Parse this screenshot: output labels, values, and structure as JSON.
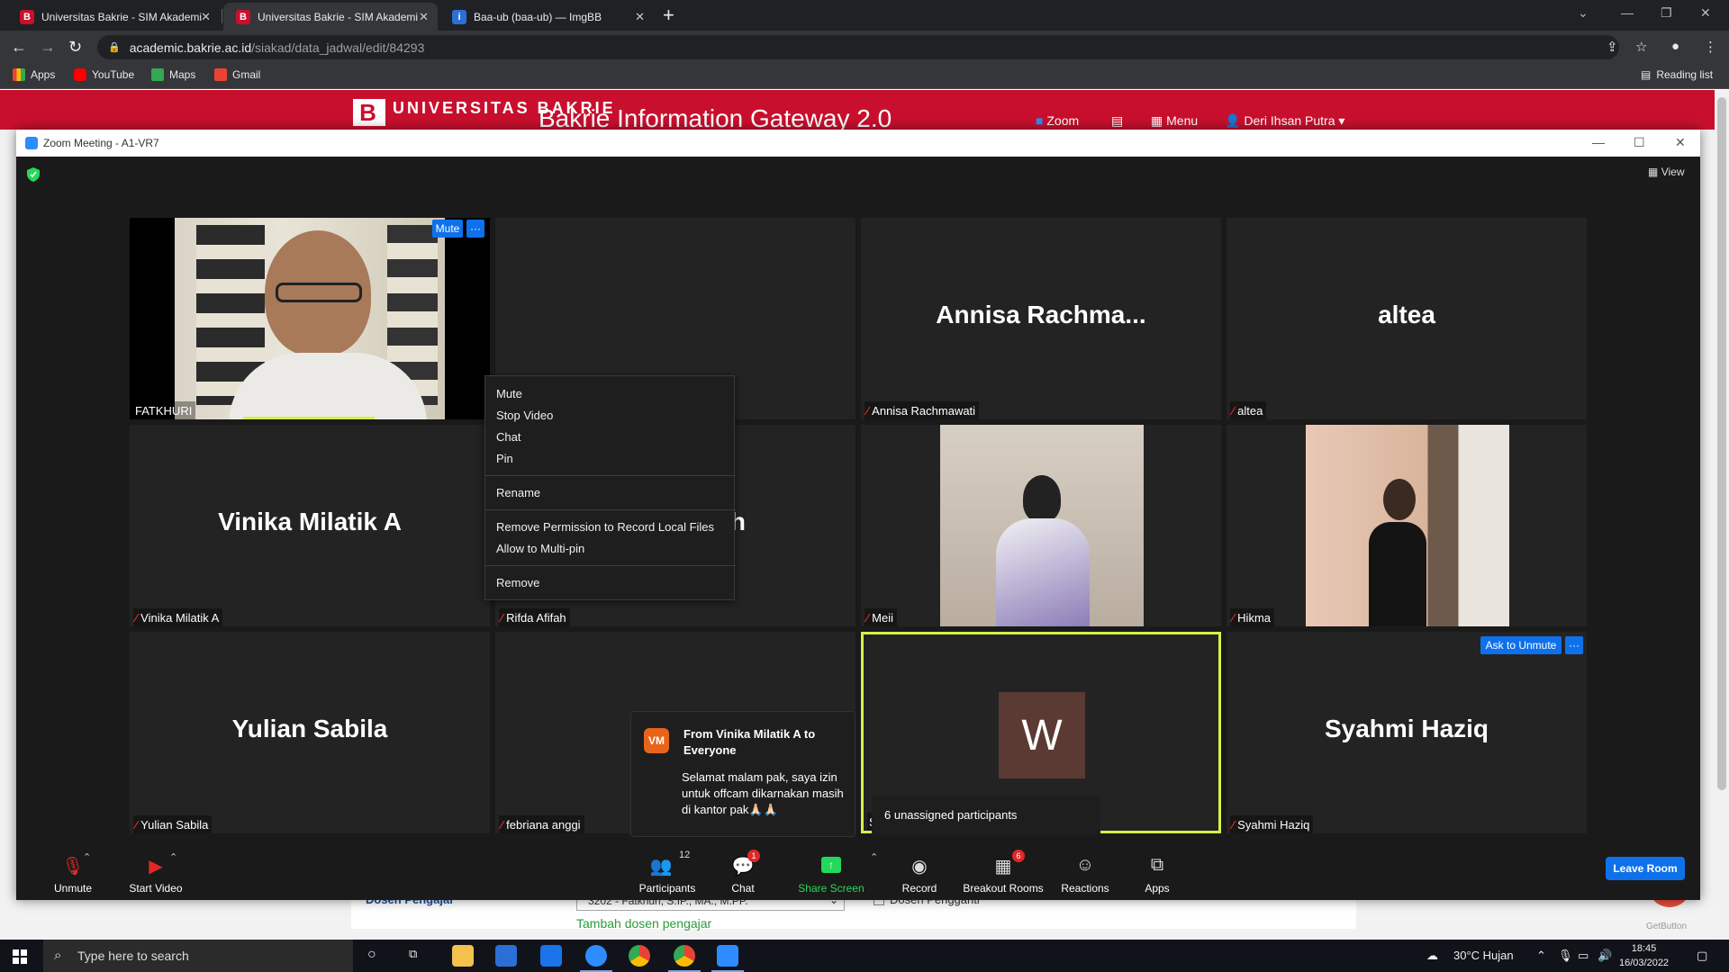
{
  "browser": {
    "tabs": [
      {
        "title": "Universitas Bakrie - SIM Akademik",
        "icon": "bakrie-favicon",
        "active": false
      },
      {
        "title": "Universitas Bakrie - SIM Akademik",
        "icon": "bakrie-favicon",
        "active": true
      },
      {
        "title": "Baa-ub (baa-ub) — ImgBB",
        "icon": "imgbb-favicon",
        "active": false
      }
    ],
    "url_host": "academic.bakrie.ac.id",
    "url_path": "/siakad/data_jadwal/edit/84293",
    "bookmarks": [
      "Apps",
      "YouTube",
      "Maps",
      "Gmail"
    ],
    "reading_list": "Reading list"
  },
  "site": {
    "logo_text": "UNIVERSITAS BAKRIE",
    "title": "Bakrie Information Gateway 2.0",
    "nav": {
      "zoom": "Zoom",
      "menu": "Menu",
      "user": "Deri Ihsan Putra"
    },
    "form": {
      "dosen_label": "Dosen Pengajar",
      "dosen_value": "3202 - Fatkhuri, S.IP., MA., M.PP.",
      "pengganti_label": "Dosen Pengganti",
      "tambah_link": "Tambah dosen pengajar"
    },
    "getbutton": "GetButton"
  },
  "zoom": {
    "window_title": "Zoom Meeting - A1-VR7",
    "view_label": "View",
    "tiles": [
      {
        "name": "FATKHURI",
        "big": "",
        "video": true
      },
      {
        "name": "",
        "big": "",
        "video": false
      },
      {
        "name": "Annisa Rachmawati",
        "big": "Annisa  Rachma...",
        "video": false
      },
      {
        "name": "altea",
        "big": "altea",
        "video": false
      },
      {
        "name": "Vinika Milatik A",
        "big": "Vinika Milatik A",
        "video": false
      },
      {
        "name": "Rifda Afifah",
        "big": "Rifda Afifah",
        "video": false
      },
      {
        "name": "Meii",
        "big": "",
        "video": true
      },
      {
        "name": "Hikma",
        "big": "",
        "video": true
      },
      {
        "name": "Yulian Sabila",
        "big": "Yulian Sabila",
        "video": false
      },
      {
        "name": "febriana anggi",
        "big": "",
        "video": false
      },
      {
        "name": "S",
        "big": "W",
        "video": false
      },
      {
        "name": "Syahmi Haziq",
        "big": "Syahmi Haziq",
        "video": false
      }
    ],
    "mute_btn": "Mute",
    "more_btn": "···",
    "ask_unmute": "Ask to Unmute",
    "context_menu": [
      "Mute",
      "Stop Video",
      "Chat",
      "Pin",
      "Rename",
      "Remove Permission to Record Local Files",
      "Allow to Multi-pin",
      "Remove"
    ],
    "chat": {
      "initials": "VM",
      "from": "From Vinika Milatik A to Everyone",
      "message": "Selamat malam pak, saya izin untuk offcam dikarnakan masih di kantor pak🙏🏻🙏🏻"
    },
    "unassigned": "6 unassigned participants",
    "toolbar": {
      "unmute": "Unmute",
      "start_video": "Start Video",
      "participants": "Participants",
      "participants_count": "12",
      "chat": "Chat",
      "chat_badge": "1",
      "share": "Share Screen",
      "record": "Record",
      "breakout": "Breakout Rooms",
      "breakout_badge": "6",
      "reactions": "Reactions",
      "apps": "Apps",
      "leave": "Leave Room"
    }
  },
  "taskbar": {
    "search_placeholder": "Type here to search",
    "weather": "30°C  Hujan",
    "time": "18:45",
    "date": "16/03/2022"
  },
  "colors": {
    "zoom_blue": "#0e71eb",
    "bakrie_red": "#c8102e",
    "active_speaker": "#d6f04a",
    "share_green": "#23d959"
  }
}
